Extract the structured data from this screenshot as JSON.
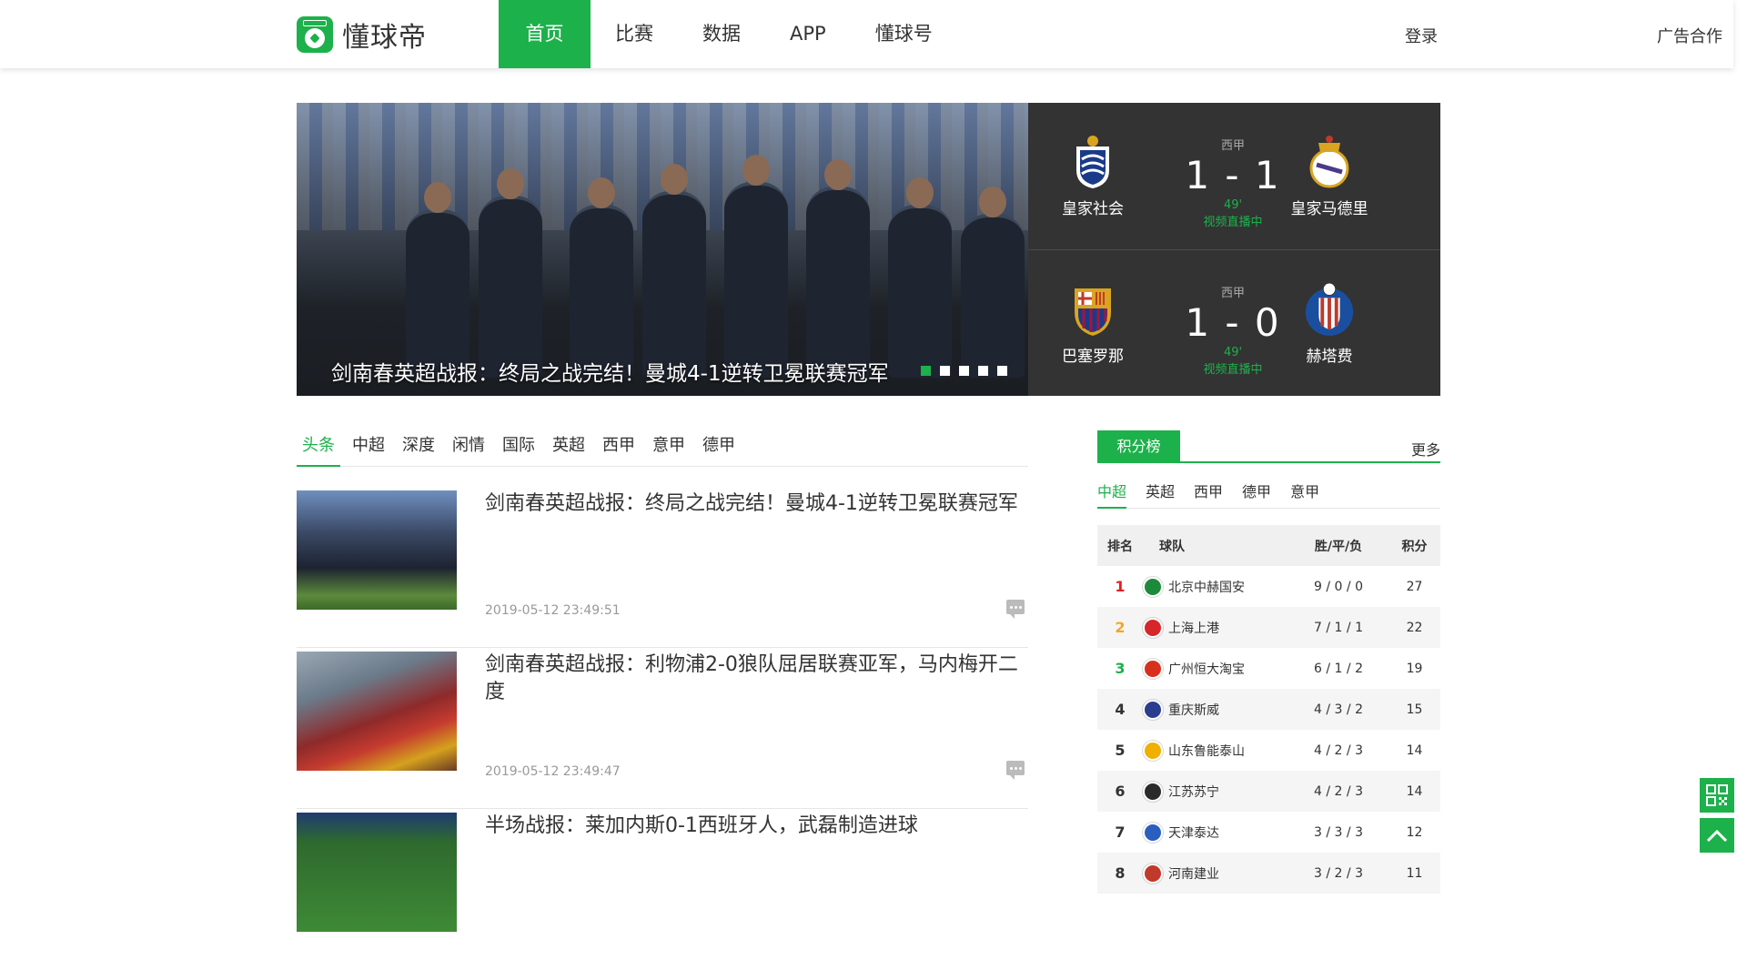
{
  "header": {
    "logo_text": "懂球帝",
    "nav": [
      "首页",
      "比赛",
      "数据",
      "APP",
      "懂球号"
    ],
    "login": "登录",
    "ad": "广告合作"
  },
  "hero": {
    "caption": "剑南春英超战报：终局之战完结！曼城4-1逆转卫冕联赛冠军",
    "slide_count": 5,
    "active_slide": 1
  },
  "matches": [
    {
      "league": "西甲",
      "home": "皇家社会",
      "away": "皇家马德里",
      "score": "1 - 1",
      "minute": "49'",
      "status": "视频直播中"
    },
    {
      "league": "西甲",
      "home": "巴塞罗那",
      "away": "赫塔费",
      "score": "1 - 0",
      "minute": "49'",
      "status": "视频直播中"
    }
  ],
  "tabs": [
    "头条",
    "中超",
    "深度",
    "闲情",
    "国际",
    "英超",
    "西甲",
    "意甲",
    "德甲"
  ],
  "news": [
    {
      "title": "剑南春英超战报：终局之战完结！曼城4-1逆转卫冕联赛冠军",
      "date": "2019-05-12 23:49:51"
    },
    {
      "title": "剑南春英超战报：利物浦2-0狼队屈居联赛亚军，马内梅开二度",
      "date": "2019-05-12 23:49:47"
    },
    {
      "title": "半场战报：莱加内斯0-1西班牙人，武磊制造进球",
      "date": ""
    }
  ],
  "standings": {
    "title": "积分榜",
    "more": "更多",
    "tabs": [
      "中超",
      "英超",
      "西甲",
      "德甲",
      "意甲"
    ],
    "headers": {
      "rank": "排名",
      "team": "球队",
      "record": "胜/平/负",
      "points": "积分"
    },
    "rows": [
      {
        "rank": "1",
        "team": "北京中赫国安",
        "record": "9 / 0 / 0",
        "points": "27"
      },
      {
        "rank": "2",
        "team": "上海上港",
        "record": "7 / 1 / 1",
        "points": "22"
      },
      {
        "rank": "3",
        "team": "广州恒大淘宝",
        "record": "6 / 1 / 2",
        "points": "19"
      },
      {
        "rank": "4",
        "team": "重庆斯威",
        "record": "4 / 3 / 2",
        "points": "15"
      },
      {
        "rank": "5",
        "team": "山东鲁能泰山",
        "record": "4 / 2 / 3",
        "points": "14"
      },
      {
        "rank": "6",
        "team": "江苏苏宁",
        "record": "4 / 2 / 3",
        "points": "14"
      },
      {
        "rank": "7",
        "team": "天津泰达",
        "record": "3 / 3 / 3",
        "points": "12"
      },
      {
        "rank": "8",
        "team": "河南建业",
        "record": "3 / 2 / 3",
        "points": "11"
      }
    ]
  },
  "colors": {
    "brand": "#1db14b",
    "rank1": "#e02020",
    "rank2": "#f5a623",
    "rank3": "#1db14b"
  },
  "icons": {
    "side_top": "qr-code-icon",
    "side_bottom": "back-to-top-icon"
  }
}
